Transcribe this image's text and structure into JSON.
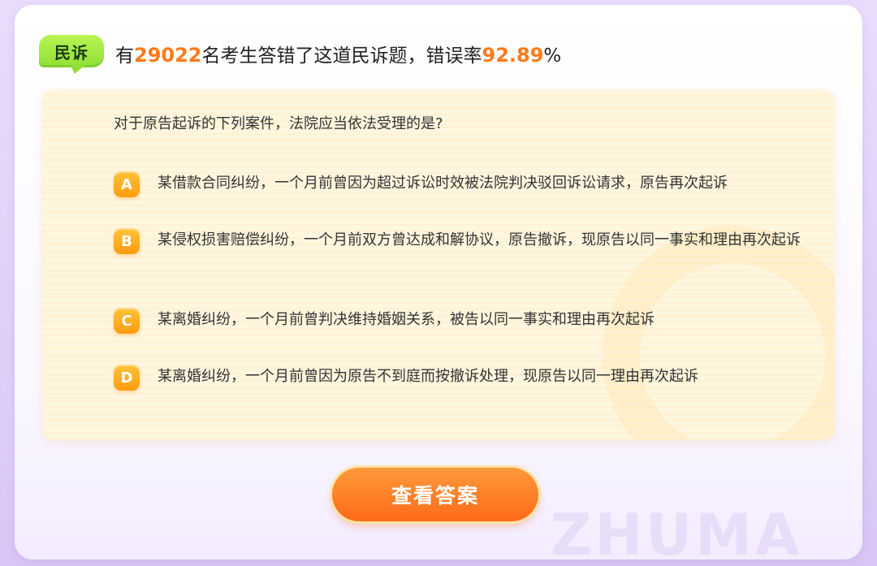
{
  "header": {
    "tag_label": "民诉",
    "prefix": "有",
    "count": "29022",
    "middle": "名考生答错了这道民诉题，错误率",
    "rate": "92.89",
    "suffix": "%"
  },
  "question": {
    "stem": "对于原告起诉的下列案件，法院应当依法受理的是?",
    "options": [
      {
        "letter": "A",
        "text": "某借款合同纠纷，一个月前曾因为超过诉讼时效被法院判决驳回诉讼请求，原告再次起诉"
      },
      {
        "letter": "B",
        "text": "某侵权损害赔偿纠纷，一个月前双方曾达成和解协议，原告撤诉，现原告以同一事实和理由再次起诉"
      },
      {
        "letter": "C",
        "text": "某离婚纠纷，一个月前曾判决维持婚姻关系，被告以同一事实和理由再次起诉"
      },
      {
        "letter": "D",
        "text": "某离婚纠纷，一个月前曾因为原告不到庭而按撤诉处理，现原告以同一理由再次起诉"
      }
    ]
  },
  "actions": {
    "view_answer_label": "查看答案"
  },
  "watermark": "ZHUMA",
  "colors": {
    "accent_orange": "#ff7a1a",
    "tag_green": "#8fe035",
    "option_badge": "#ffa21f",
    "background_purple": "#e2d2f8"
  }
}
